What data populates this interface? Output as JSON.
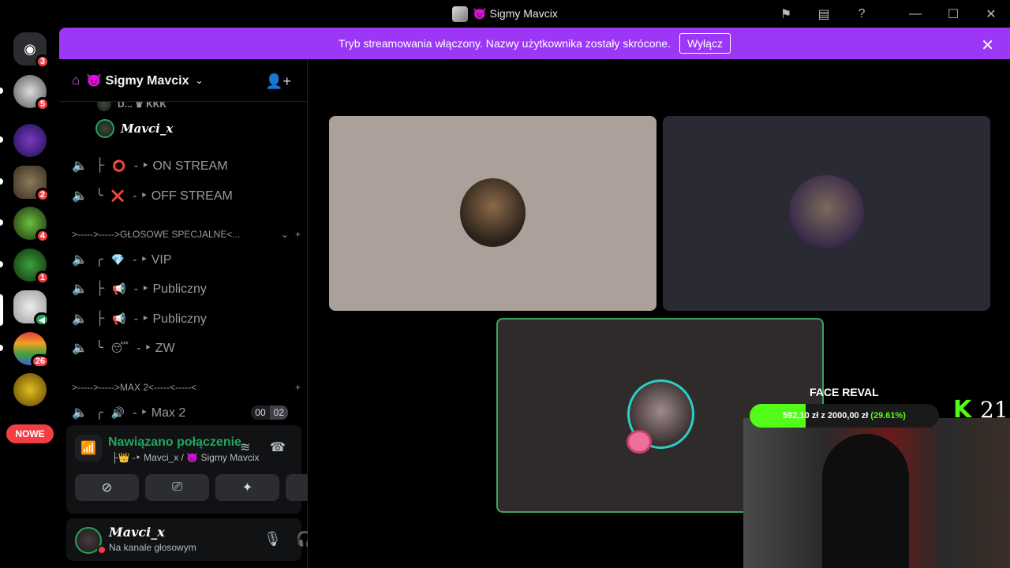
{
  "window": {
    "title": "👿 Sigmy Mavcix",
    "controls": {
      "minimize": "—",
      "maximize": "☐",
      "close": "✕"
    },
    "toolbar_icons": [
      "flag-icon",
      "inbox-icon",
      "help-icon"
    ]
  },
  "servers": {
    "items": [
      {
        "name": "discord-home",
        "badge": "3"
      },
      {
        "name": "server-1",
        "badge": "5"
      },
      {
        "name": "server-zakon",
        "badge": ""
      },
      {
        "name": "server-3",
        "badge": "2"
      },
      {
        "name": "server-4",
        "badge": "4"
      },
      {
        "name": "server-5",
        "badge": "1"
      },
      {
        "name": "server-6",
        "badge": ""
      },
      {
        "name": "server-7",
        "badge": "26"
      },
      {
        "name": "server-8",
        "badge": ""
      }
    ],
    "new_pill": "NOWE"
  },
  "banner": {
    "text": "Tryb streamowania włączony. Nazwy użytkownika zostały skrócone.",
    "button": "Wyłącz",
    "close": "✕"
  },
  "guild": {
    "name": "👿 Sigmy Mavcix",
    "chevron": "⌄"
  },
  "channels": {
    "partial_user": "D... ♛ KKK",
    "user_in_channel": "Mavci_x",
    "voice": [
      {
        "prefix": "├",
        "emoji": "⭕",
        "name": "- ‣ ON STREAM"
      },
      {
        "prefix": "╰",
        "emoji": "❌",
        "name": "- ‣ OFF STREAM"
      }
    ],
    "category1": ">----->----->GŁOSOWE SPECJALNE<...",
    "voice2": [
      {
        "prefix": "╭",
        "emoji": "💎",
        "name": "- ‣ VIP"
      },
      {
        "prefix": "├",
        "emoji": "📢",
        "name": "- ‣ Publiczny"
      },
      {
        "prefix": "├",
        "emoji": "📢",
        "name": "- ‣  Publiczny"
      },
      {
        "prefix": "╰",
        "emoji": "😴",
        "name": "- ‣ ZW"
      }
    ],
    "category2": ">----->----->MAX 2<-----<-----<",
    "max2": {
      "prefix": "╭",
      "emoji": "🔊",
      "name": "- ‣ Max 2",
      "count_left": "00",
      "count_right": "02"
    }
  },
  "voice_panel": {
    "status": "Nawiązano połączenie",
    "channel": "├👑 -‣ Mavci_x / 👿 Sigmy Mavcix"
  },
  "user_panel": {
    "username": "Mavci_x",
    "status": "Na kanale głosowym"
  },
  "overlay": {
    "title": "FACE REVAL",
    "goal_text": "592,10 zł z 2000,00 zł",
    "goal_pct": "(29.61%)",
    "goal_fraction": 0.2961,
    "kick_count": "21",
    "kick_letter": "K"
  },
  "colors": {
    "banner": "#9b37f5",
    "connected": "#23a55a",
    "badge": "#f23f43",
    "kick": "#53fc18"
  }
}
